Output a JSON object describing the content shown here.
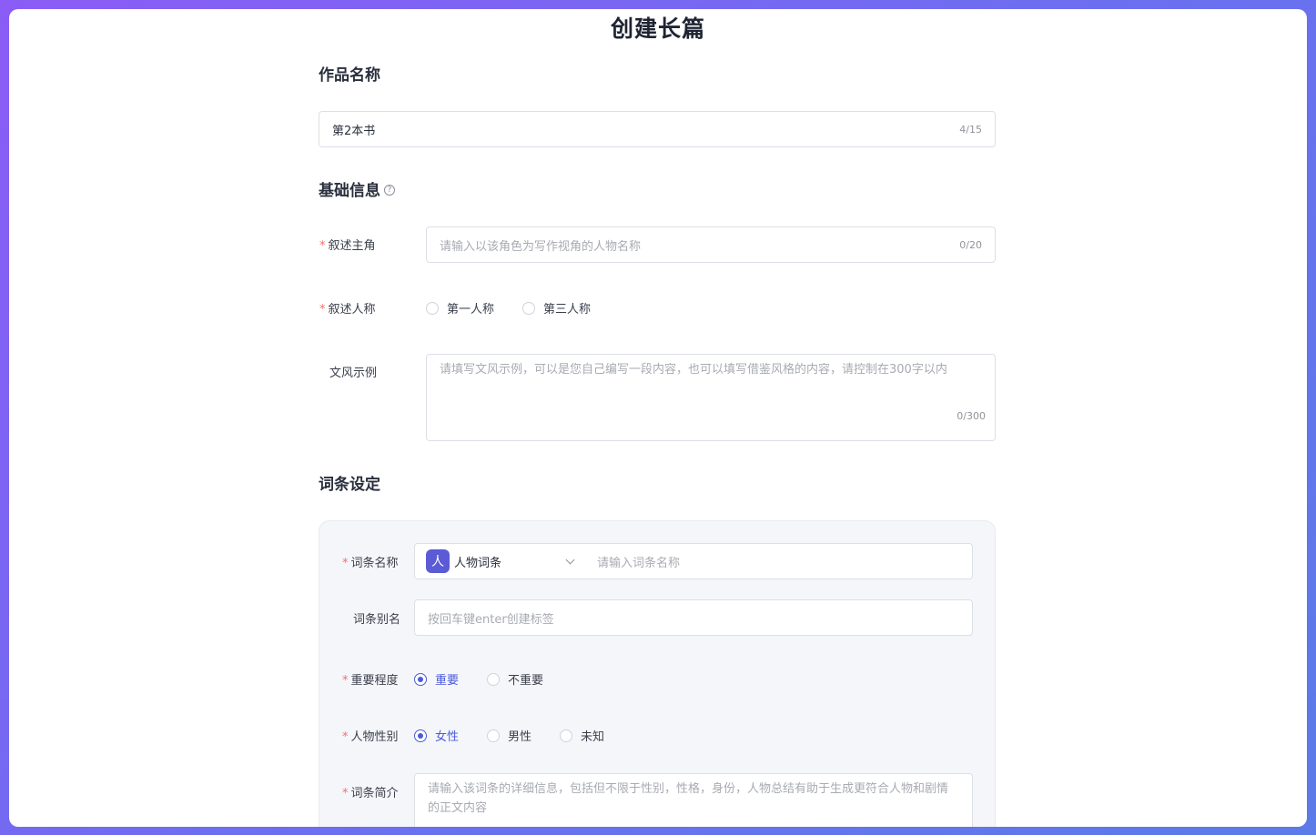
{
  "page_title": "创建长篇",
  "work_name": {
    "section_title": "作品名称",
    "value": "第2本书",
    "counter": "4/15"
  },
  "basic_info": {
    "section_title": "基础信息",
    "help_glyph": "?",
    "protagonist": {
      "label": "叙述主角",
      "placeholder": "请输入以该角色为写作视角的人物名称",
      "counter": "0/20"
    },
    "narrative_person": {
      "label": "叙述人称",
      "options": [
        "第一人称",
        "第三人称"
      ],
      "selected": null
    },
    "style_example": {
      "label": "文风示例",
      "placeholder": "请填写文风示例，可以是您自己编写一段内容，也可以填写借鉴风格的内容，请控制在300字以内",
      "counter": "0/300"
    }
  },
  "term_settings": {
    "section_title": "词条设定",
    "term_name": {
      "label": "词条名称",
      "type_badge": "人",
      "type_label": "人物词条",
      "placeholder": "请输入词条名称"
    },
    "alias": {
      "label": "词条别名",
      "placeholder": "按回车键enter创建标签"
    },
    "importance": {
      "label": "重要程度",
      "options": [
        "重要",
        "不重要"
      ],
      "selected": "重要"
    },
    "gender": {
      "label": "人物性别",
      "options": [
        "女性",
        "男性",
        "未知"
      ],
      "selected": "女性"
    },
    "intro": {
      "label": "词条简介",
      "placeholder": "请输入该词条的详细信息，包括但不限于性别，性格，身份，人物总结有助于生成更符合人物和剧情的正文内容"
    }
  },
  "colors": {
    "accent": "#4b5bd8",
    "required": "#f56c6c",
    "badge": "#5b5bd6",
    "panel_bg": "#f5f6fa"
  }
}
